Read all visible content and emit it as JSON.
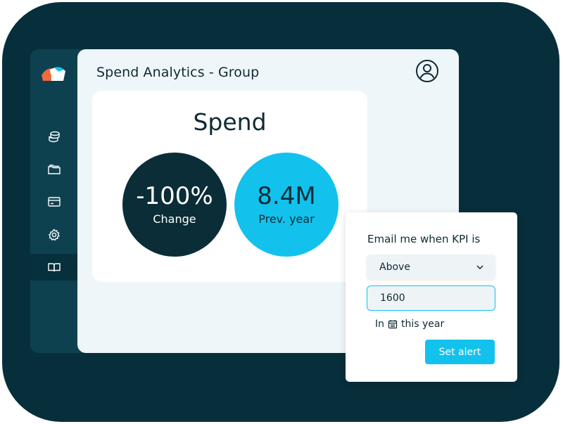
{
  "header": {
    "title": "Spend Analytics - Group",
    "user_icon": "user-circle-icon"
  },
  "sidebar": {
    "logo": "brand-logo",
    "items": [
      {
        "icon": "database-icon"
      },
      {
        "icon": "folder-icon"
      },
      {
        "icon": "credit-card-icon"
      },
      {
        "icon": "gear-icon"
      },
      {
        "icon": "book-icon",
        "active": true
      }
    ]
  },
  "kpi_card": {
    "title": "Spend",
    "metrics": [
      {
        "value": "-100%",
        "label": "Change",
        "color": "#0a2d37"
      },
      {
        "value": "8.4M",
        "label": "Prev. year",
        "color": "#12c2ec"
      }
    ]
  },
  "alert": {
    "title": "Email me when KPI is",
    "condition": "Above",
    "threshold": "1600",
    "period_prefix": "In",
    "period": "this year",
    "button": "Set alert"
  },
  "colors": {
    "background": "#072f3b",
    "sidebar": "#0e4150",
    "accent": "#12c2ec",
    "dark": "#0a2d37"
  }
}
